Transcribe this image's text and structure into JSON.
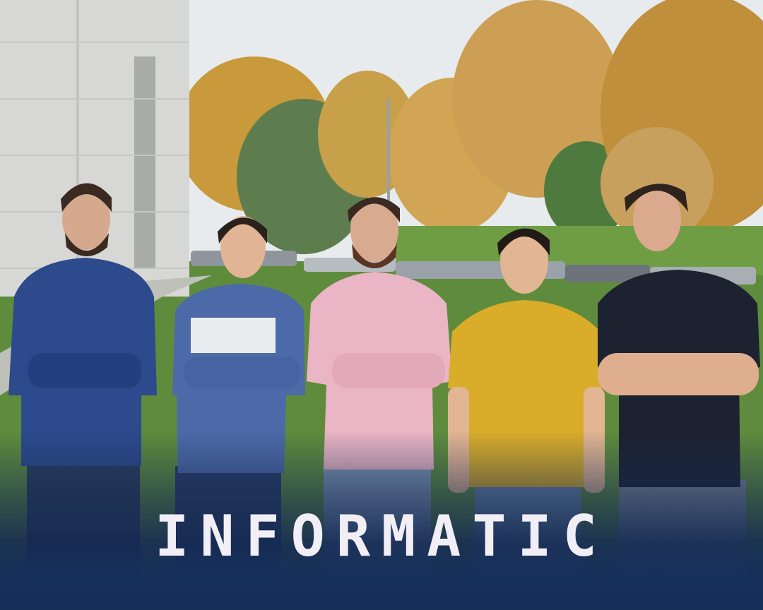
{
  "headline": {
    "text": "INFORMATIC",
    "color": "#f1eef6"
  },
  "colors": {
    "sky": "#e7ebee",
    "grass": "#5f8c3c",
    "foliage_autumn": "#c99a3c",
    "foliage_green": "#5e7d4e",
    "building": "#d7d8d5",
    "overlay_navy": "#16305c"
  },
  "people": [
    {
      "name": "person-1-navy-jacket",
      "top": "#2c4a8c",
      "bottom": "#2c3d5c"
    },
    {
      "name": "person-2-blue-sweater",
      "top": "#4c6aa8",
      "bottom": "#2b3c66"
    },
    {
      "name": "person-3-pink-shirt",
      "top": "#eab5c4",
      "bottom": "#7f96b4"
    },
    {
      "name": "person-4-yellow-tshirt",
      "top": "#d9ad2a",
      "bottom": "#6b86aa"
    },
    {
      "name": "person-5-black-tshirt",
      "top": "#1d2230",
      "bottom": "#7c8896"
    }
  ]
}
